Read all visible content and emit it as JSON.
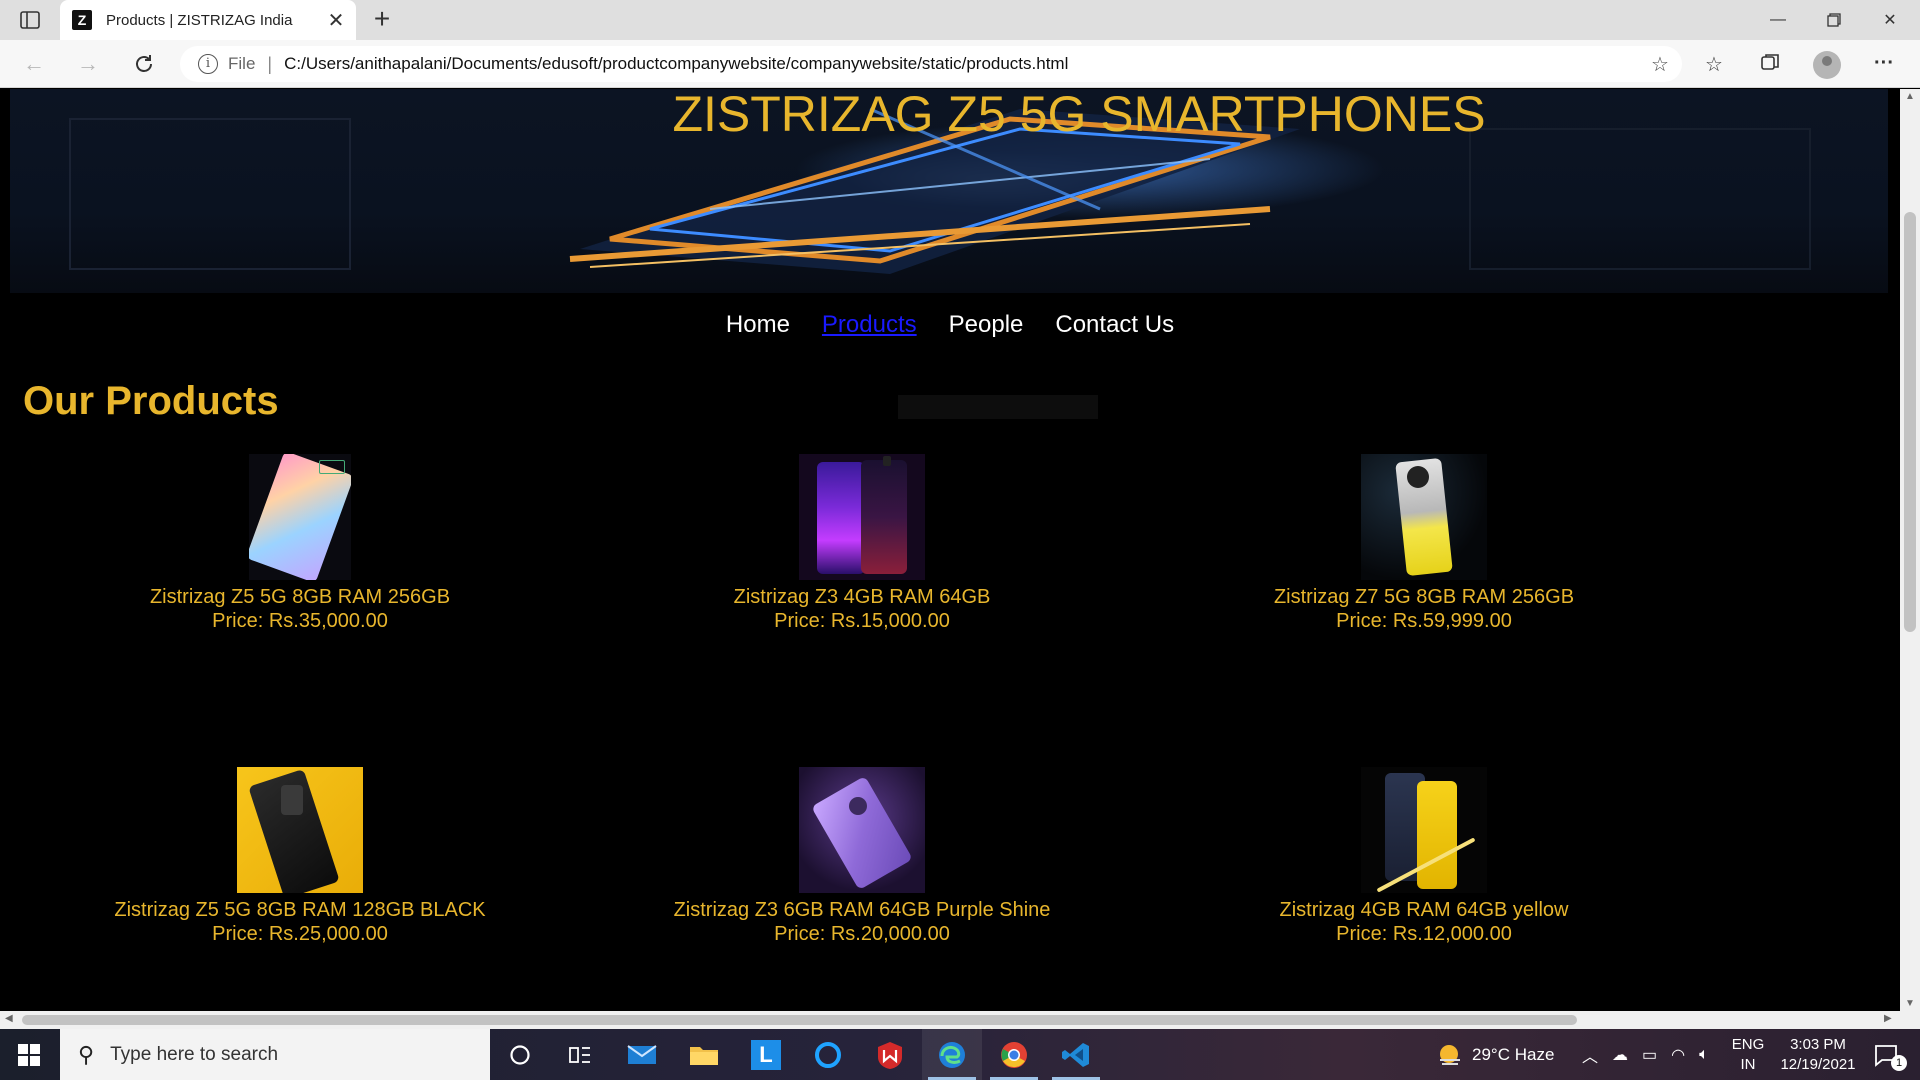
{
  "browser": {
    "tab_title": "Products | ZISTRIZAG India",
    "tab_favicon": "Z",
    "address_scheme": "File",
    "address_url": "C:/Users/anithapalani/Documents/edusoft/productcompanywebsite/companywebsite/static/products.html"
  },
  "page": {
    "banner_title": "ZISTRIZAG Z5 5G SMARTPHONES",
    "nav": [
      "Home",
      "Products",
      "People",
      "Contact Us"
    ],
    "active_nav": "Products",
    "section_heading": "Our Products",
    "products": [
      {
        "name": "Zistrizag Z5 5G 8GB RAM 256GB",
        "price": "Price: Rs.35,000.00",
        "image": "phone-iridescent"
      },
      {
        "name": "Zistrizag Z3 4GB RAM 64GB",
        "price": "Price: Rs.15,000.00",
        "image": "phone-purple-popup"
      },
      {
        "name": "Zistrizag Z7 5G 8GB RAM 256GB",
        "price": "Price: Rs.59,999.00",
        "image": "phone-silver-yellow"
      },
      {
        "name": "Zistrizag Z5 5G 8GB RAM 128GB BLACK",
        "price": "Price: Rs.25,000.00",
        "image": "phone-black-on-yellow"
      },
      {
        "name": "Zistrizag Z3 6GB RAM 64GB Purple Shine",
        "price": "Price: Rs.20,000.00",
        "image": "phone-purple-shine"
      },
      {
        "name": "Zistrizag 4GB RAM 64GB yellow",
        "price": "Price: Rs.12,000.00",
        "image": "phone-yellow-pair"
      }
    ]
  },
  "taskbar": {
    "search_placeholder": "Type here to search",
    "weather": "29°C  Haze",
    "lang_top": "ENG",
    "lang_bottom": "IN",
    "time": "3:03 PM",
    "date": "12/19/2021",
    "notification_count": "1"
  },
  "colors": {
    "accent_gold": "#e8b62d",
    "active_link": "#1a1aff"
  }
}
